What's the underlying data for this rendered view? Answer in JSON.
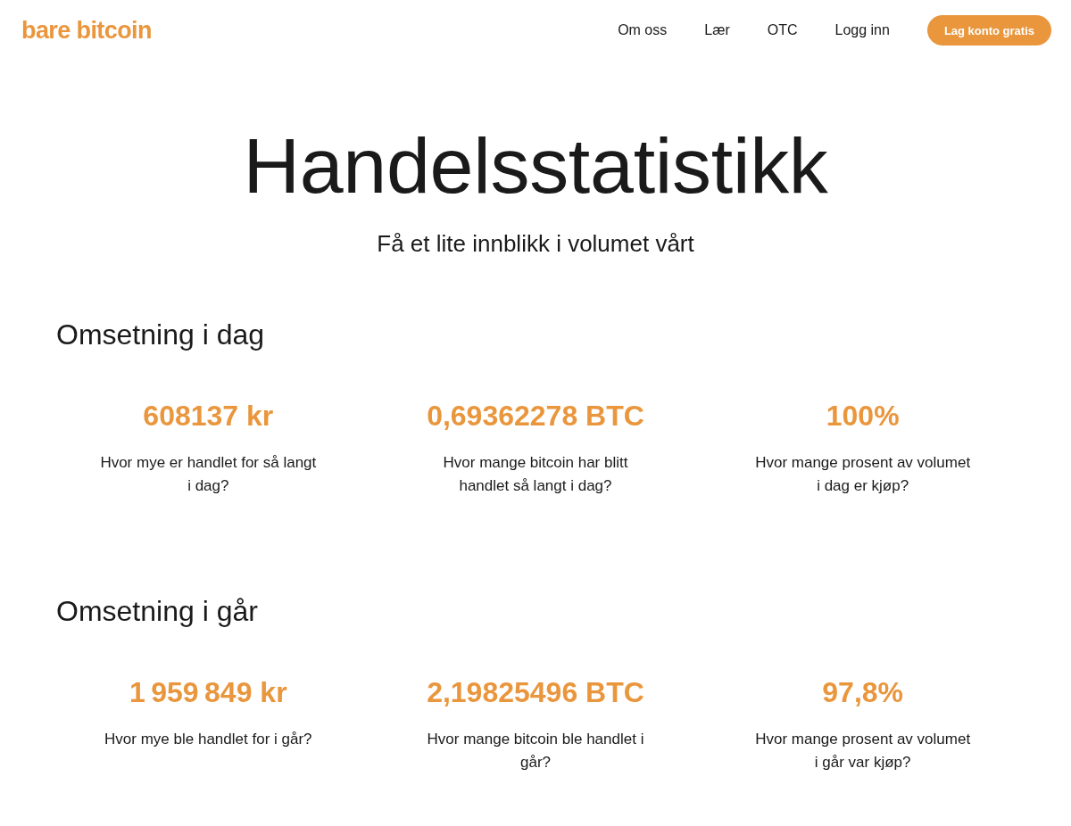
{
  "header": {
    "logo": "bare bitcoin",
    "nav": [
      "Om oss",
      "Lær",
      "OTC",
      "Logg inn"
    ],
    "cta": "Lag konto gratis"
  },
  "hero": {
    "title": "Handelsstatistikk",
    "subtitle": "Få et lite innblikk i volumet vårt"
  },
  "sections": [
    {
      "heading": "Omsetning i dag",
      "stats": [
        {
          "value": "608137 kr",
          "description": "Hvor mye er handlet for så langt i dag?"
        },
        {
          "value": "0,69362278 BTC",
          "description": "Hvor mange bitcoin har blitt handlet så langt i dag?"
        },
        {
          "value": "100%",
          "description": "Hvor mange prosent av volumet i dag er kjøp?"
        }
      ]
    },
    {
      "heading": "Omsetning i går",
      "stats": [
        {
          "value": "1 959 849 kr",
          "description": "Hvor mye ble handlet for i går?"
        },
        {
          "value": "2,19825496 BTC",
          "description": "Hvor mange bitcoin ble handlet i går?"
        },
        {
          "value": "97,8%",
          "description": "Hvor mange prosent av volumet i går var kjøp?"
        }
      ]
    }
  ]
}
